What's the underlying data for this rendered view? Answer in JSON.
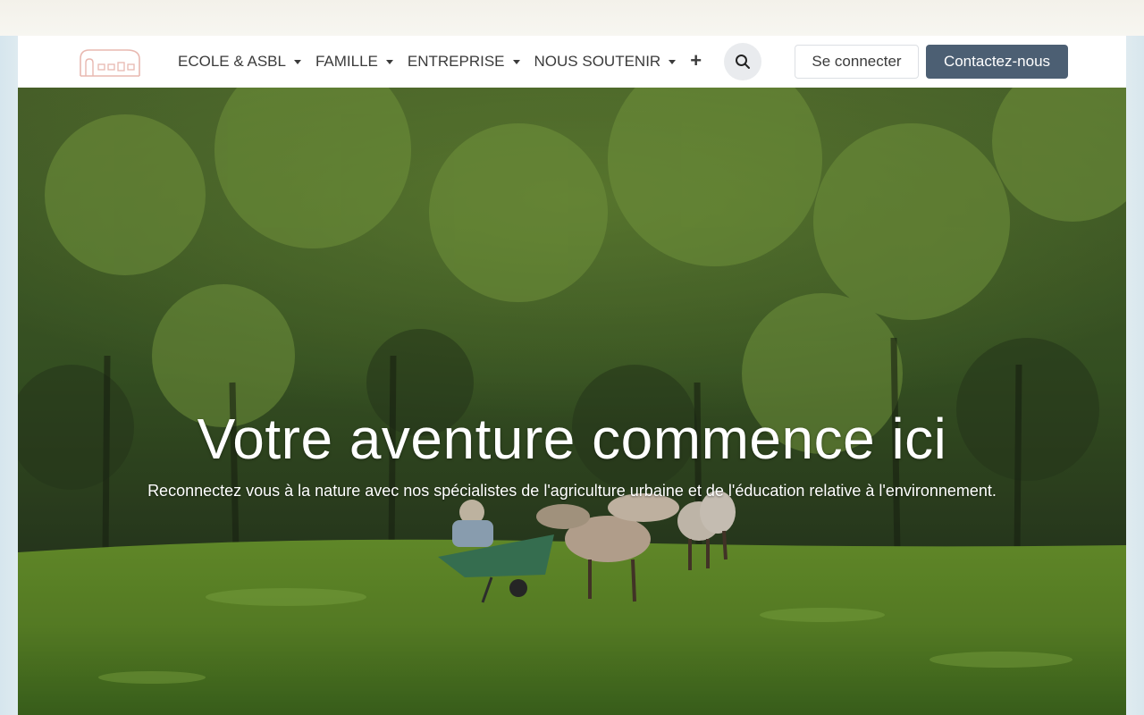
{
  "header": {
    "logo_icon": "farm-building-logo",
    "nav": [
      {
        "label": "ECOLE & ASBL"
      },
      {
        "label": "FAMILLE"
      },
      {
        "label": "ENTREPRISE"
      },
      {
        "label": "NOUS SOUTENIR"
      }
    ],
    "more_label": "+",
    "search_icon": "search-icon",
    "login_label": "Se connecter",
    "contact_label": "Contactez-nous"
  },
  "hero": {
    "title": "Votre aventure commence ici",
    "subtitle": "Reconnectez vous à la nature avec nos spécialistes de l'agriculture urbaine et de l'éducation relative à l'environnement.",
    "image": "children-feeding-sheep-in-park"
  },
  "colors": {
    "contact_button": "#4c5f73",
    "logo_stroke": "#e8b8b0",
    "text": "#3b3b3b"
  }
}
